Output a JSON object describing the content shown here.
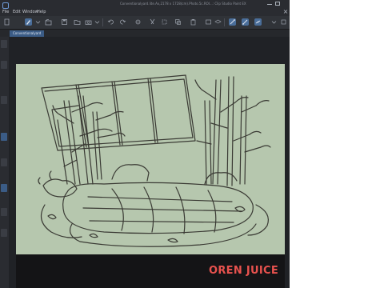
{
  "menubar": {
    "items": [
      "File",
      "Edit",
      "Window",
      "Help"
    ],
    "document_title": "Conventionalyard.lite.Ax,2178 x 1728(cm).Photo.5c.ROI...:  Clip Studio Paint EX"
  },
  "tabs": {
    "active_label": "Conventionalyard"
  },
  "toolbar": {
    "icons": [
      "new-file-icon",
      "open-file-icon",
      "save-icon",
      "undo-icon",
      "redo-icon",
      "cut-icon",
      "copy-icon",
      "paste-icon",
      "transform-icon",
      "settings-icon",
      "snap-to-ruler-icon",
      "snap-to-grid-icon",
      "snap-to-special-ruler-icon",
      "canvas-icon"
    ]
  },
  "colors": {
    "canvas_bg": "#b6c7ae",
    "app_bg": "#1d1f23",
    "accent": "#3b5c86",
    "watermark": "#e8524e"
  },
  "watermark": "OREN JUICE"
}
